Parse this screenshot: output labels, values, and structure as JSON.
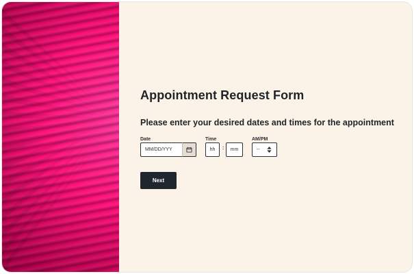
{
  "form": {
    "title": "Appointment Request Form",
    "subtitle": "Please enter your desired dates and times for the appointment",
    "date": {
      "label": "Date",
      "placeholder": "MM/DD/YYY",
      "value": ""
    },
    "time": {
      "label": "Time",
      "hours_placeholder": "hh",
      "minutes_placeholder": "mm",
      "separator": ":"
    },
    "ampm": {
      "label": "AM/PM",
      "selected": "--"
    },
    "next_button_label": "Next"
  },
  "icons": {
    "calendar": "calendar-icon",
    "ampm_caret": "updown-caret-icon"
  },
  "colors": {
    "page_background": "#fcf3e8",
    "hero_pink": "#ff0f79",
    "primary_button": "#1f262d"
  }
}
